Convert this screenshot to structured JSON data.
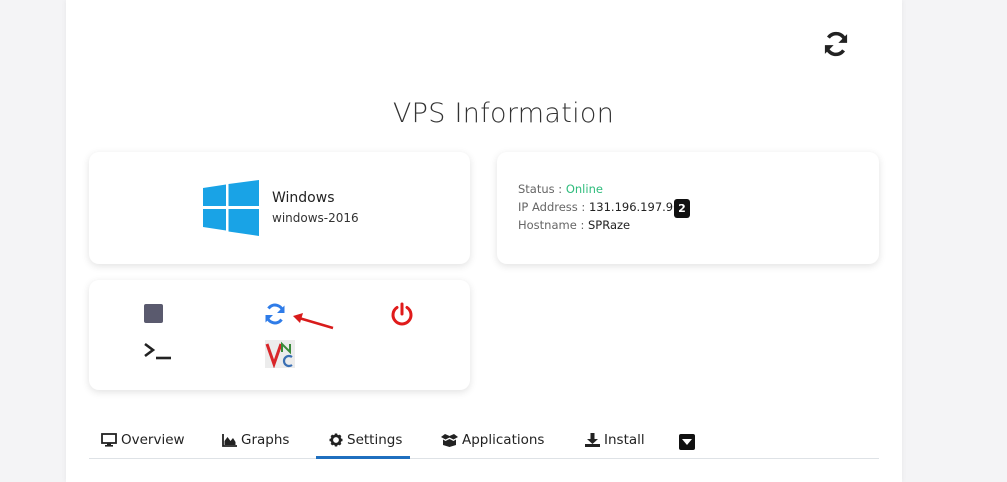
{
  "page": {
    "title": "VPS Information"
  },
  "os": {
    "name": "Windows",
    "version": "windows-2016"
  },
  "info": {
    "status_label": "Status : ",
    "status_value": "Online",
    "ip_label": "IP Address : ",
    "ip_value": "131.196.197.90",
    "ip_badge": "2",
    "hostname_label": "Hostname : ",
    "hostname_value": "SPRaze"
  },
  "tabs": [
    {
      "label": "Overview",
      "icon": "monitor-icon"
    },
    {
      "label": "Graphs",
      "icon": "area-chart-icon"
    },
    {
      "label": "Settings",
      "icon": "gear-icon",
      "active": true
    },
    {
      "label": "Applications",
      "icon": "box-open-icon"
    },
    {
      "label": "Install",
      "icon": "download-icon"
    }
  ],
  "colors": {
    "online": "#2ebc7c",
    "restart_blue": "#2f7ce8",
    "power_red": "#e01b1b",
    "active_tab": "#1f6fbf",
    "windows_blue": "#19a3e6"
  },
  "actions": [
    "stop-icon",
    "restart-icon",
    "power-icon",
    "console-icon",
    "vnc-icon"
  ]
}
